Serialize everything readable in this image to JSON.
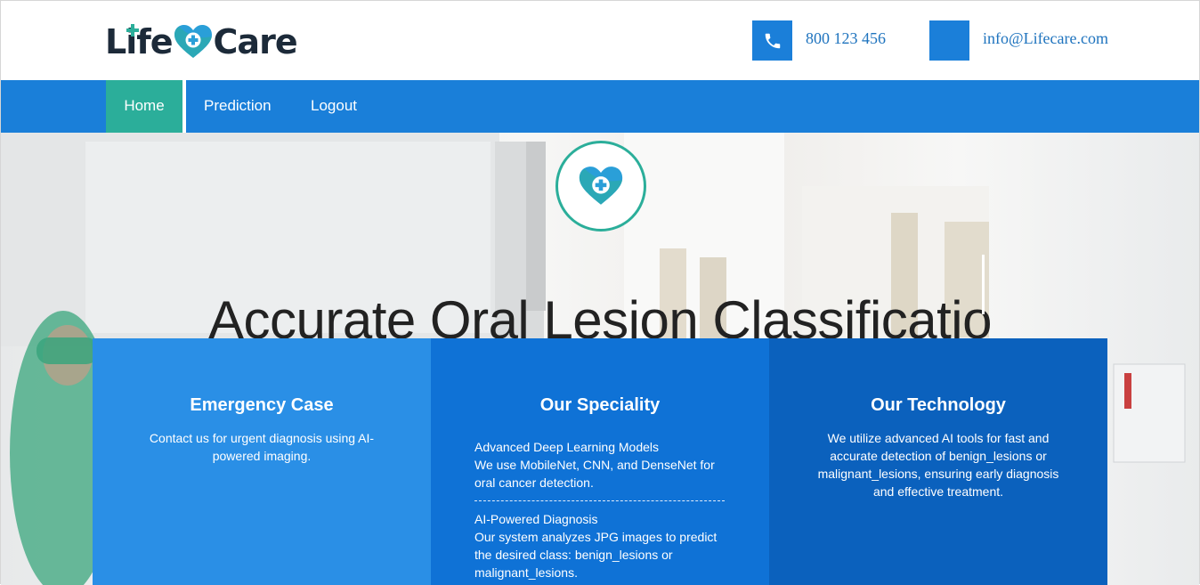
{
  "brand": {
    "name_left": "Life",
    "name_right": "Care"
  },
  "contacts": {
    "phone": {
      "icon": "phone-icon",
      "text": "800 123 456"
    },
    "email": {
      "icon": "mail-icon",
      "text": "info@Lifecare.com"
    }
  },
  "nav": {
    "items": [
      {
        "label": "Home",
        "active": true
      },
      {
        "label": "Prediction"
      },
      {
        "label": "Logout"
      }
    ]
  },
  "hero": {
    "title": "Accurate Oral Lesion Classificatio"
  },
  "cards": [
    {
      "title": "Emergency Case",
      "description": "Contact us for urgent diagnosis using AI-powered imaging."
    },
    {
      "title": "Our Speciality",
      "items": [
        {
          "heading": "Advanced Deep Learning Models",
          "text": "We use MobileNet, CNN, and DenseNet for oral cancer detection."
        },
        {
          "heading": "AI-Powered Diagnosis",
          "text": "Our system analyzes JPG images to predict the desired class: benign_lesions or malignant_lesions."
        }
      ]
    },
    {
      "title": "Our Technology",
      "description": "We utilize advanced AI tools for fast and accurate detection of benign_lesions or malignant_lesions, ensuring early diagnosis and effective treatment."
    }
  ],
  "colors": {
    "primary": "#1a7fd9",
    "accent": "#2bae9a",
    "card1": "#2a8fe6",
    "card2": "#0f72d6",
    "card3": "#0b61bd",
    "dark": "#1c2a39"
  }
}
